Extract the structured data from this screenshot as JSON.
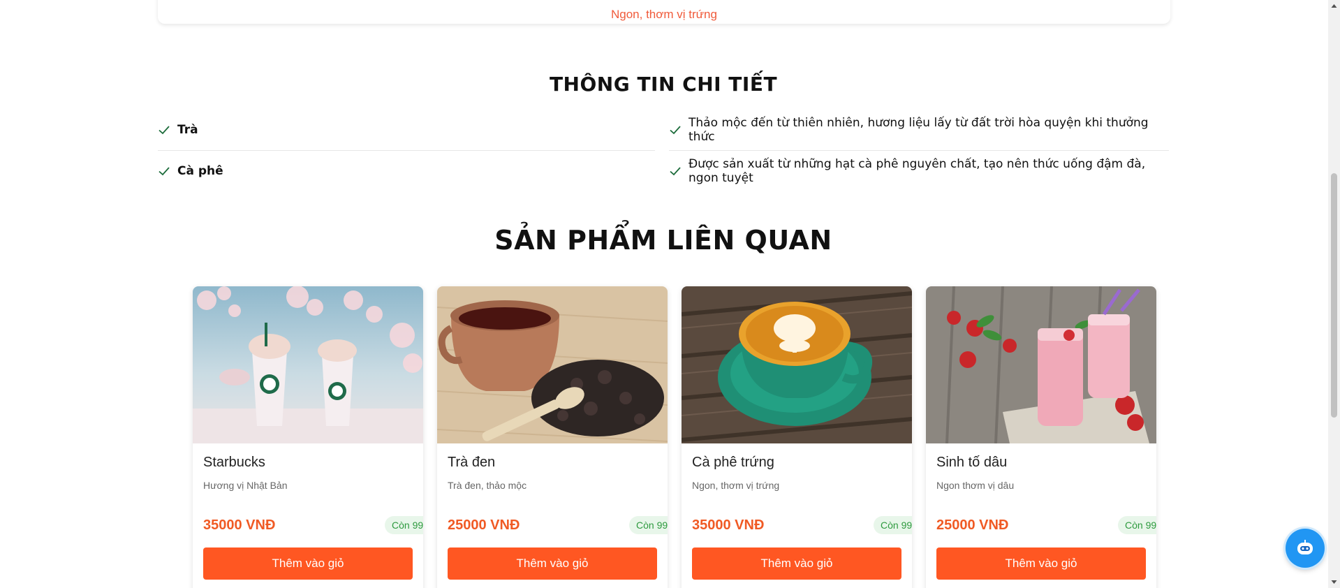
{
  "top_card": {
    "text": "Ngon, thơm vị trứng"
  },
  "details": {
    "title": "THÔNG TIN CHI TIẾT",
    "rows": [
      {
        "key": "Trà",
        "value": "Thảo mộc đến từ thiên nhiên, hương liệu lấy từ đất trời hòa quyện khi thưởng thức"
      },
      {
        "key": "Cà phê",
        "value": "Được sản xuất từ những hạt cà phê nguyên chất, tạo nên thức uống đậm đà, ngon tuyệt"
      }
    ]
  },
  "related": {
    "title": "SẢN PHẨM LIÊN QUAN",
    "products": [
      {
        "name": "Starbucks",
        "desc": "Hương vị Nhật Bản",
        "price": "35000 VNĐ",
        "stock": "Còn 99",
        "button": "Thêm vào giỏ",
        "image": "starbucks-drinks-image"
      },
      {
        "name": "Trà đen",
        "desc": "Trà đen, thảo mộc",
        "price": "25000 VNĐ",
        "stock": "Còn 99",
        "button": "Thêm vào giỏ",
        "image": "black-tea-image"
      },
      {
        "name": "Cà phê trứng",
        "desc": "Ngon, thơm vị trứng",
        "price": "35000 VNĐ",
        "stock": "Còn 99",
        "button": "Thêm vào giỏ",
        "image": "latte-image"
      },
      {
        "name": "Sinh tố dâu",
        "desc": "Ngon thơm vị dâu",
        "price": "25000 VNĐ",
        "stock": "Còn 99",
        "button": "Thêm vào giỏ",
        "image": "strawberry-smoothie-image"
      }
    ]
  },
  "colors": {
    "accent": "#ff5722",
    "price": "#f05a24",
    "stock_bg": "#e8f6ea",
    "stock_text": "#2e9a3f",
    "chat": "#2196f3"
  },
  "chat": {
    "icon": "chatbot-icon"
  }
}
